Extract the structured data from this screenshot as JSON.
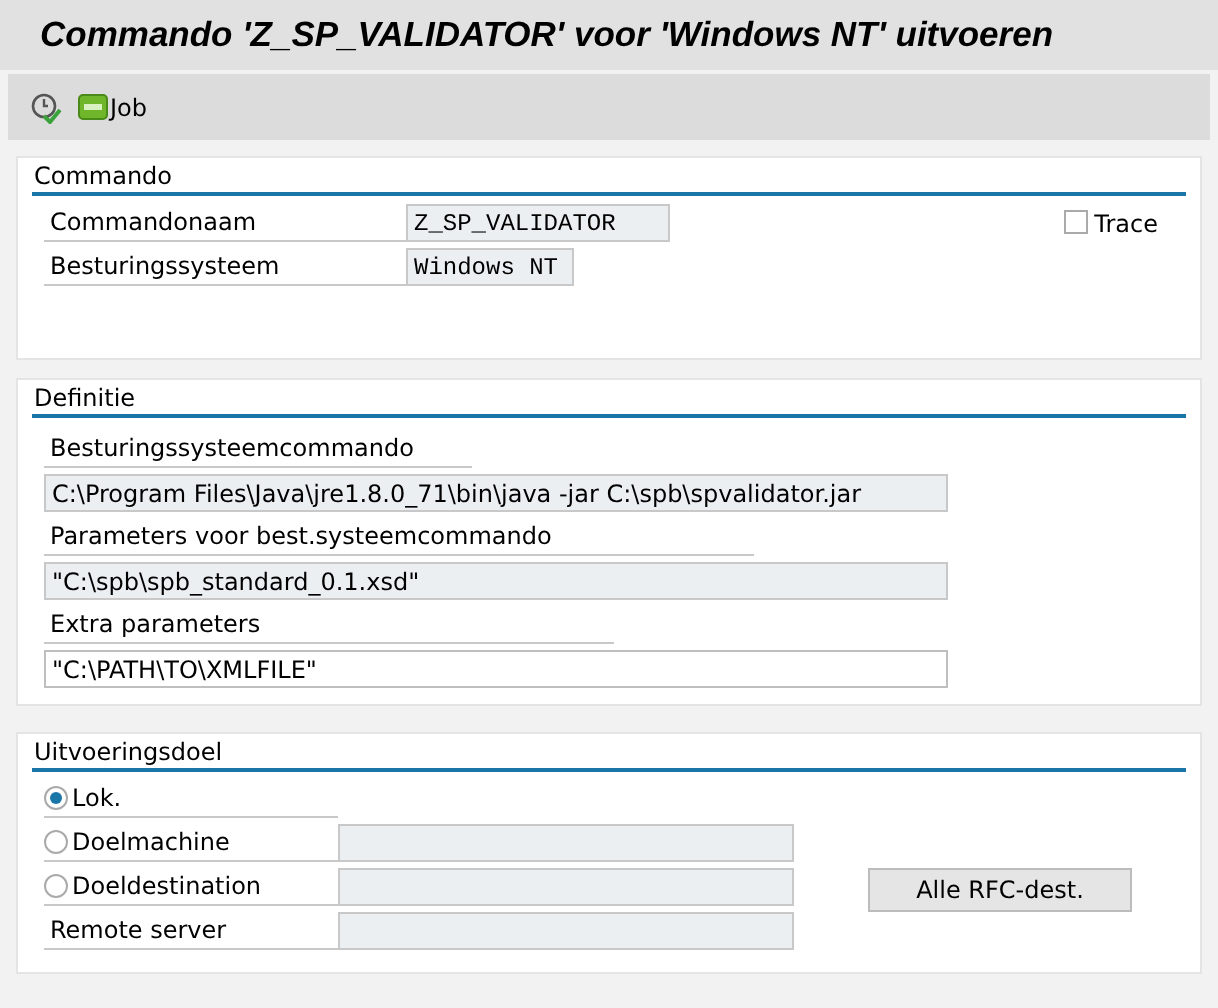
{
  "title": "Commando 'Z_SP_VALIDATOR' voor 'Windows NT' uitvoeren",
  "toolbar": [
    {
      "kind": "execute-icon"
    },
    {
      "kind": "job",
      "label": "Job"
    }
  ],
  "commando": {
    "heading": "Commando",
    "fields": [
      {
        "label": "Commandonaam",
        "value": "Z_SP_VALIDATOR",
        "disabled": true
      },
      {
        "label": "Besturingssysteem",
        "value": "Windows NT",
        "disabled": true
      }
    ],
    "trace": {
      "label": "Trace",
      "checked": false
    }
  },
  "definitie": {
    "heading": "Definitie",
    "fields": [
      {
        "label": "Besturingssysteemcommando",
        "value": "C:\\Program Files\\Java\\jre1.8.0_71\\bin\\java -jar C:\\spb\\spvalidator.jar",
        "disabled": true
      },
      {
        "label": "Parameters voor best.systeemcommando",
        "value": "\"C:\\spb\\spb_standard_0.1.xsd\"",
        "disabled": true
      },
      {
        "label": "Extra parameters",
        "value": "\"C:\\PATH\\TO\\XMLFILE\"",
        "disabled": false
      }
    ]
  },
  "uitvoeringsdoel": {
    "heading": "Uitvoeringsdoel",
    "rows": [
      {
        "kind": "radio",
        "label": "Lok.",
        "selected": true
      },
      {
        "kind": "radio",
        "label": "Doelmachine",
        "selected": false,
        "field": {
          "disabled": true
        }
      },
      {
        "kind": "radio",
        "label": "Doeldestination",
        "selected": false,
        "field": {
          "disabled": true
        }
      },
      {
        "kind": "label",
        "label": "Remote server",
        "field": {
          "disabled": true
        }
      }
    ],
    "button": "Alle RFC-dest."
  }
}
